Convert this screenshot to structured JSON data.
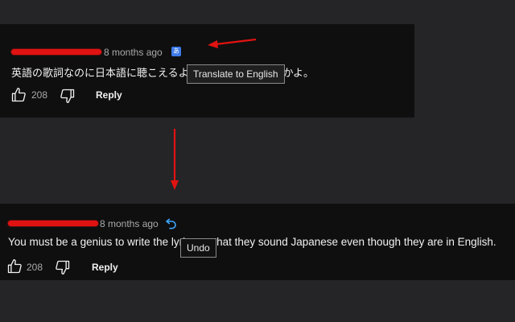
{
  "comment_original": {
    "time": "8 months ago",
    "text": "英語の歌詞なのに日本語に聴こえるように書けるとか天才かよ。",
    "likes": "208",
    "reply_label": "Reply",
    "translate_icon": "translate-icon",
    "tooltip": "Translate to English"
  },
  "comment_translated": {
    "time": "8 months ago",
    "text": "You must be a genius to write the lyrics so that they sound Japanese even though they are in English.",
    "likes": "208",
    "reply_label": "Reply",
    "undo_icon": "undo-icon",
    "tooltip": "Undo"
  },
  "colors": {
    "panel": "#0f0f0f",
    "page": "#252527",
    "annotation_red": "#e11212",
    "undo_blue": "#3ea6ff",
    "translate_blue": "#3d7ae8"
  }
}
